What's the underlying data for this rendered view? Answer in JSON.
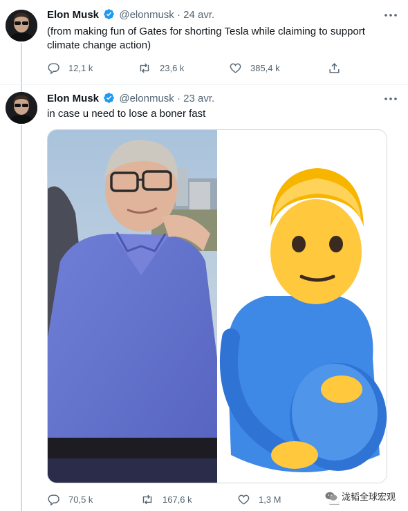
{
  "tweets": [
    {
      "author": {
        "name": "Elon Musk",
        "handle": "@elonmusk"
      },
      "separator": "·",
      "date": "24 avr.",
      "text_lines": [
        "(from making fun of Gates for shorting Tesla while claiming to support",
        "climate change action)"
      ],
      "actions": {
        "replies": "12,1 k",
        "retweets": "23,6 k",
        "likes": "385,4 k"
      }
    },
    {
      "author": {
        "name": "Elon Musk",
        "handle": "@elonmusk"
      },
      "separator": "·",
      "date": "23 avr.",
      "text_lines": [
        "in case u need to lose a boner fast"
      ],
      "actions": {
        "replies": "70,5 k",
        "retweets": "167,6 k",
        "likes": "1,3 M"
      }
    }
  ],
  "watermark": {
    "text": "泷韬全球宏观"
  },
  "colors": {
    "accent": "#1d9bf0",
    "secondary_text": "#536471",
    "thread_line": "#cfd9de"
  },
  "icons": [
    "verified-badge-icon",
    "more-options-icon",
    "reply-icon",
    "retweet-icon",
    "like-icon",
    "share-icon",
    "wechat-icon"
  ]
}
